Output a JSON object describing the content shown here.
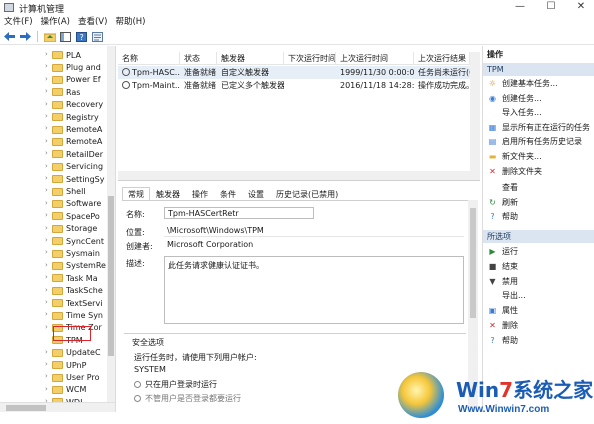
{
  "window": {
    "title": "计算机管理",
    "controls": [
      "—",
      "☐",
      "✕"
    ]
  },
  "menubar": [
    "文件(F)",
    "操作(A)",
    "查看(V)",
    "帮助(H)"
  ],
  "tree": {
    "items": [
      {
        "label": "PLA",
        "expandable": true
      },
      {
        "label": "Plug and",
        "expandable": true
      },
      {
        "label": "Power Ef",
        "expandable": true
      },
      {
        "label": "Ras",
        "expandable": true
      },
      {
        "label": "Recovery",
        "expandable": true
      },
      {
        "label": "Registry",
        "expandable": true
      },
      {
        "label": "RemoteA",
        "expandable": true
      },
      {
        "label": "RemoteA",
        "expandable": true
      },
      {
        "label": "RetailDer",
        "expandable": true
      },
      {
        "label": "Servicing",
        "expandable": true
      },
      {
        "label": "SettingSy",
        "expandable": true
      },
      {
        "label": "Shell",
        "expandable": true
      },
      {
        "label": "Software",
        "expandable": true
      },
      {
        "label": "SpacePo",
        "expandable": true
      },
      {
        "label": "Storage",
        "expandable": true
      },
      {
        "label": "SyncCent",
        "expandable": true
      },
      {
        "label": "Sysmain",
        "expandable": true
      },
      {
        "label": "SystemRe",
        "expandable": true
      },
      {
        "label": "Task Ma",
        "expandable": true
      },
      {
        "label": "TaskSche",
        "expandable": true
      },
      {
        "label": "TextServi",
        "expandable": true
      },
      {
        "label": "Time Syn",
        "expandable": true
      },
      {
        "label": "Time Zor",
        "expandable": true
      },
      {
        "label": "TPM",
        "expandable": false,
        "selected": true
      },
      {
        "label": "UpdateC",
        "expandable": true
      },
      {
        "label": "UPnP",
        "expandable": true
      },
      {
        "label": "User Pro",
        "expandable": true
      },
      {
        "label": "WCM",
        "expandable": true
      },
      {
        "label": "WDI",
        "expandable": true
      }
    ]
  },
  "tasklist": {
    "columns": [
      "名称",
      "状态",
      "触发器",
      "下次运行时间",
      "上次运行时间",
      "上次运行结果"
    ],
    "rows": [
      [
        "Tpm-HASC...",
        "准备就绪",
        "自定义触发器",
        "",
        "1999/11/30 0:00:00",
        "任务尚未运行(0x4"
      ],
      [
        "Tpm-Maint...",
        "准备就绪",
        "已定义多个触发器",
        "",
        "2016/11/18 14:28:19",
        "操作成功完成。"
      ]
    ]
  },
  "detail": {
    "tabs": [
      "常规",
      "触发器",
      "操作",
      "条件",
      "设置",
      "历史记录(已禁用)"
    ],
    "fields": {
      "name_label": "名称:",
      "name_value": "Tpm-HASCertRetr",
      "location_label": "位置:",
      "location_value": "\\Microsoft\\Windows\\TPM",
      "author_label": "创建者:",
      "author_value": "Microsoft Corporation",
      "desc_label": "描述:",
      "desc_value": "此任务请求健康认证证书。"
    },
    "security": {
      "title": "安全选项",
      "run_as_label": "运行任务时，请使用下列用户帐户:",
      "account": "SYSTEM",
      "option1": "只在用户登录时运行",
      "option2": "不管用户是否登录都要运行"
    }
  },
  "actions": {
    "header": "操作",
    "section1": "TPM",
    "items1": [
      {
        "label": "创建基本任务...",
        "icon": "create-basic-task-icon"
      },
      {
        "label": "创建任务...",
        "icon": "create-task-icon"
      },
      {
        "label": "导入任务...",
        "icon": "import-task-icon"
      },
      {
        "label": "显示所有正在运行的任务",
        "icon": "running-tasks-icon"
      },
      {
        "label": "启用所有任务历史记录",
        "icon": "history-icon"
      },
      {
        "label": "新文件夹...",
        "icon": "new-folder-icon"
      },
      {
        "label": "删除文件夹",
        "icon": "delete-icon"
      },
      {
        "label": "查看",
        "icon": "view-icon"
      },
      {
        "label": "刷新",
        "icon": "refresh-icon"
      },
      {
        "label": "帮助",
        "icon": "help-icon"
      }
    ],
    "section2": "所选项",
    "items2": [
      {
        "label": "运行",
        "icon": "run-icon"
      },
      {
        "label": "结束",
        "icon": "stop-icon"
      },
      {
        "label": "禁用",
        "icon": "disable-icon"
      },
      {
        "label": "导出...",
        "icon": "export-icon"
      },
      {
        "label": "属性",
        "icon": "properties-icon"
      },
      {
        "label": "删除",
        "icon": "delete-icon"
      },
      {
        "label": "帮助",
        "icon": "help-icon"
      }
    ]
  },
  "watermark": {
    "brand_a": "Win",
    "brand_b": "7",
    "brand_c": "系统之家",
    "url": "Www.Winwin7.com"
  },
  "colors": {
    "highlight_border": "#d9262c",
    "section_bg": "#dbe5f1",
    "folder": "#f3cf6a"
  }
}
